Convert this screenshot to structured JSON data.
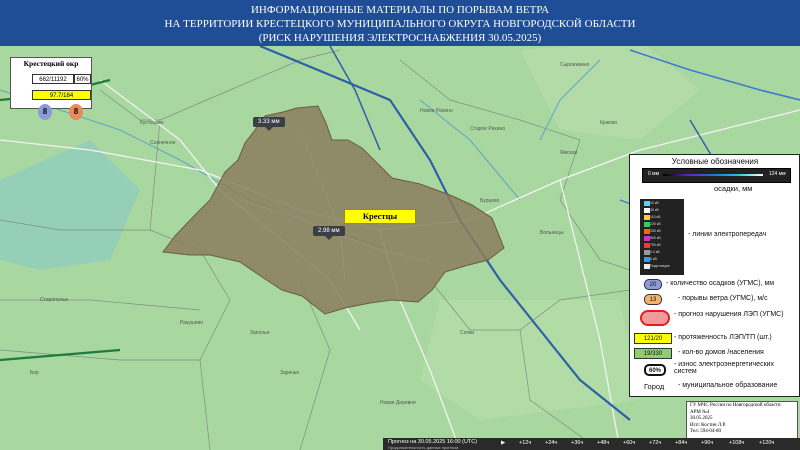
{
  "header": {
    "line1": "ИНФОРМАЦИОННЫЕ МАТЕРИАЛЫ ПО ПОРЫВАМ ВЕТРА",
    "line2": "НА ТЕРРИТОРИИ КРЕСТЕЦКОГО МУНИЦИПАЛЬНОГО ОКРУГА НОВГОРОДСКОЙ ОБЛАСТИ",
    "line3": "(РИСК НАРУШЕНИЯ ЭЛЕКТРОСНАБЖЕНИЯ 30.05.2025)"
  },
  "district": {
    "title": "Крестецкий окр",
    "houses": "662/11192",
    "percent": "60%",
    "lines": "97.7/184",
    "precip_badge": "8",
    "gust_badge": "8"
  },
  "map": {
    "pins": [
      {
        "label": "3.33 мм"
      },
      {
        "label": "2.98 мм"
      }
    ],
    "city": "Крестцы",
    "place_labels": [
      "Сыроежкино",
      "Новое Рахино",
      "Старое Рахино",
      "Ямская",
      "Бурцево",
      "Кустецкие",
      "Солнечное",
      "Старополье",
      "Ракушево",
      "Вольницы",
      "Заполье",
      "Сопки",
      "Бор",
      "Новая Деревня",
      "Кржево",
      "Заречье"
    ]
  },
  "legend": {
    "title": "Условные обозначения",
    "precip_min": "0 мм",
    "precip_max": "124 мм",
    "precip_label": "осадки, мм",
    "power_lines_label": "- линии электропередач",
    "power_line_items": [
      "10 кВ",
      "35 кВ",
      "110 кВ",
      "220 кВ",
      "330 кВ",
      "500 кВ",
      "750 кВ",
      "0.4 кВ",
      "6 кВ",
      "Подстанция"
    ],
    "precip_count_sym": "20",
    "precip_count_label": "- количество осадков (УГМС), мм",
    "gust_sym": "13",
    "gust_label": "- порывы ветра (УГМС), м/с",
    "forecast_label": "- прогноз нарушения ЛЭП (УГМС)",
    "length_sym": "121/20",
    "length_label": "- протяженность ЛЭП/ТП (шт.)",
    "houses_sym": "19/330",
    "houses_label": "- кол-во домов /населения",
    "index_sym": "60%",
    "index_label": "- износ электроэнергетических систем",
    "city_sym": "Город",
    "city_label": "- муниципальное образование"
  },
  "footer": {
    "lines": [
      "ГУ МЧС России по Новгородской области",
      "АРМ №4",
      "30.05.2025",
      "Исп: Костин Л.Р.",
      "Тел: 594-04-80"
    ]
  },
  "timebar": {
    "text": "Прогноз на 30.05.2025 16:00 (UTC)",
    "subtext": "Продолжительность данных прогноза",
    "buttons": [
      "▶",
      "+12ч",
      "+24ч",
      "+36ч",
      "+48ч",
      "+60ч",
      "+72ч",
      "+84ч",
      "+96ч",
      "+108ч",
      "+120ч"
    ]
  },
  "colors": {
    "header_bg": "#1f4e96",
    "map_bg": "#a9d7a0",
    "district_fill": "#8b7d5e",
    "city_label_bg": "#ffff00"
  }
}
